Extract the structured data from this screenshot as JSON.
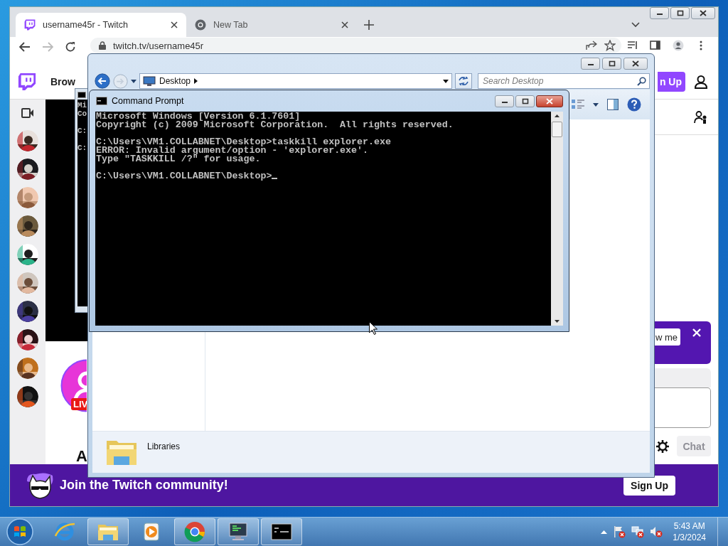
{
  "browser": {
    "window_buttons": [
      {
        "kind": "minimize"
      },
      {
        "kind": "maximize"
      },
      {
        "kind": "close"
      }
    ],
    "tabs": [
      {
        "kind": "site",
        "title": "username45r - Twitch",
        "selected": true
      },
      {
        "kind": "newtab",
        "title": "New Tab",
        "selected": false
      }
    ],
    "nav_buttons": [
      {
        "kind": "back",
        "disabled": false
      },
      {
        "kind": "forward",
        "disabled": true
      },
      {
        "kind": "reload",
        "disabled": false
      }
    ],
    "url": "twitch.tv/username45r"
  },
  "twitch": {
    "browse": "Brow",
    "sign_up": "n Up",
    "live_badge": "LIV",
    "heading": "A",
    "follow_button": "w me",
    "chat_button": {
      "label": "Chat",
      "disabled": true
    },
    "banner": {
      "text": "Join the Twitch community!",
      "button": "Sign Up"
    }
  },
  "background_console": {
    "blocks": [
      [
        "Mi",
        "Co"
      ],
      [
        "C:"
      ],
      [
        "C:"
      ]
    ]
  },
  "explorer": {
    "window_buttons": [
      {
        "kind": "minimize"
      },
      {
        "kind": "maximize"
      },
      {
        "kind": "close"
      }
    ],
    "address": "Desktop",
    "search": {
      "placeholder": "Search Desktop"
    },
    "details": "Libraries"
  },
  "command_prompt": {
    "title": "Command Prompt",
    "window_buttons": [
      {
        "kind": "minimize"
      },
      {
        "kind": "maximize"
      },
      {
        "kind": "close"
      }
    ],
    "blocks": [
      [
        "Microsoft Windows [Version 6.1.7601]",
        "Copyright (c) 2009 Microsoft Corporation.  All rights reserved."
      ],
      [
        "C:\\Users\\VM1.COLLABNET\\Desktop>taskkill explorer.exe",
        "ERROR: Invalid argument/option - 'explorer.exe'.",
        "Type \"TASKKILL /?\" for usage."
      ],
      [
        "C:\\Users\\VM1.COLLABNET\\Desktop>"
      ]
    ],
    "cursor": true
  },
  "taskbar": {
    "items": [
      {
        "kind": "e-browser",
        "running": false
      },
      {
        "kind": "folder",
        "running": true
      },
      {
        "kind": "media",
        "running": false
      },
      {
        "kind": "circle-browser",
        "running": true
      },
      {
        "kind": "monitor",
        "running": true
      },
      {
        "kind": "terminal",
        "running": true
      }
    ],
    "time": "5:43 AM",
    "date": "1/3/2024"
  }
}
